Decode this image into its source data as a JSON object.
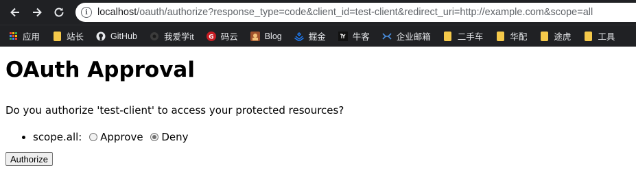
{
  "browser": {
    "url_host": "localhost",
    "url_rest": "/oauth/authorize?response_type=code&client_id=test-client&redirect_uri=http://example.com&scope=all",
    "nav_icons": [
      "back-arrow-icon",
      "forward-arrow-icon",
      "reload-icon"
    ],
    "info_glyph": "i"
  },
  "bookmarks": [
    {
      "label": "应用",
      "icon": "apps-grid-icon"
    },
    {
      "label": "站长",
      "icon": "folder-icon"
    },
    {
      "label": "GitHub",
      "icon": "github-icon"
    },
    {
      "label": "我爱学it",
      "icon": "site-icon"
    },
    {
      "label": "码云",
      "icon": "gitee-icon"
    },
    {
      "label": "Blog",
      "icon": "blog-icon"
    },
    {
      "label": "掘金",
      "icon": "juejin-icon"
    },
    {
      "label": "牛客",
      "icon": "nowcoder-icon"
    },
    {
      "label": "企业邮箱",
      "icon": "mail-icon"
    },
    {
      "label": "二手车",
      "icon": "folder-icon"
    },
    {
      "label": "华配",
      "icon": "folder-icon"
    },
    {
      "label": "途虎",
      "icon": "folder-icon"
    },
    {
      "label": "工具",
      "icon": "folder-icon"
    }
  ],
  "page": {
    "title": "OAuth Approval",
    "question": "Do you authorize 'test-client' to access your protected resources?",
    "scope": {
      "label": "scope.all:",
      "approve_label": "Approve",
      "deny_label": "Deny",
      "selected": "Deny"
    },
    "submit_label": "Authorize"
  },
  "colors": {
    "chrome_bg": "#202124",
    "folder": "#f5c94a"
  }
}
